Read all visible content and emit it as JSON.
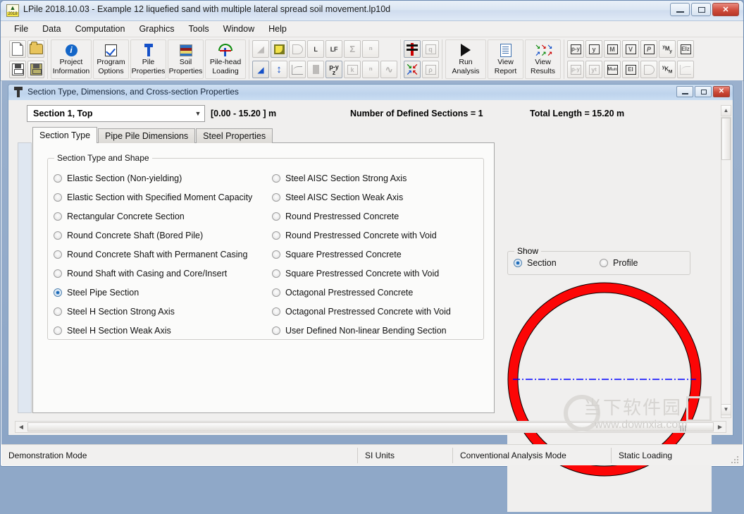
{
  "window": {
    "title": "LPile 2018.10.03 - Example 12 liquefied sand with multiple lateral spread soil movement.lp10d",
    "app_icon": "lpile-icon",
    "icon_year": "2018",
    "minimize_label": "Minimize",
    "maximize_label": "Maximize",
    "close_label": "Close"
  },
  "menu": {
    "items": [
      {
        "label": "File"
      },
      {
        "label": "Data"
      },
      {
        "label": "Computation"
      },
      {
        "label": "Graphics"
      },
      {
        "label": "Tools"
      },
      {
        "label": "Window"
      },
      {
        "label": "Help"
      }
    ]
  },
  "toolbar": {
    "file_buttons": [
      {
        "name": "new-file",
        "glyph": "new-document-icon"
      },
      {
        "name": "open-file",
        "glyph": "open-folder-icon"
      },
      {
        "name": "save-file",
        "glyph": "save-disk-icon"
      },
      {
        "name": "save-as-file",
        "glyph": "save-as-disk-icon"
      }
    ],
    "big_buttons": [
      {
        "name": "project-information",
        "line1": "Project",
        "line2": "Information",
        "icon": "info-circle-icon"
      },
      {
        "name": "program-options",
        "line1": "Program",
        "line2": "Options",
        "icon": "checkbox-icon"
      },
      {
        "name": "pile-properties",
        "line1": "Pile",
        "line2": "Properties",
        "icon": "pile-icon"
      },
      {
        "name": "soil-properties",
        "line1": "Soil",
        "line2": "Properties",
        "icon": "soil-layers-icon"
      },
      {
        "name": "pile-head-loading",
        "line1": "Pile-head",
        "line2": "Loading",
        "icon": "pile-head-load-icon"
      }
    ],
    "action_buttons": [
      {
        "name": "run-analysis",
        "line1": "Run",
        "line2": "Analysis",
        "icon": "play-triangle-icon"
      },
      {
        "name": "view-report",
        "line1": "View",
        "line2": "Report",
        "icon": "report-document-icon"
      },
      {
        "name": "view-results",
        "line1": "View",
        "line2": "Results",
        "icon": "colored-curves-icon"
      }
    ],
    "grid_icons_row1": [
      "soil-layer-chart-icon",
      "yellow-curve-icon",
      "d-shape-icon",
      "L",
      "LF",
      "Σ",
      "slope-icon"
    ],
    "grid_icons_row2": [
      "pile-section-icon",
      "updown-arrow-icon",
      "curve-icon",
      "column-icon",
      "p-y z",
      "k-icon",
      "slope-icon-2",
      "s-curve-icon"
    ],
    "load_icons": [
      "pile-top-load-icon",
      "q",
      "colored-arrows-icon",
      "rho"
    ],
    "result_icons_row1": [
      "p-y",
      "y",
      "M",
      "V",
      "P",
      "yMy",
      "EIz"
    ],
    "result_icons_row2": [
      "p-y",
      "yt",
      "Mult",
      "EI",
      "d-shape",
      "yKm",
      "curve-dim"
    ]
  },
  "child_window": {
    "title": "Section Type, Dimensions, and Cross-section Properties",
    "icon": "pile-section-icon",
    "minimize_label": "Minimize",
    "maximize_label": "Maximize",
    "close_label": "Close"
  },
  "section_bar": {
    "selected_section": "Section 1, Top",
    "dropdown_options": [
      "Section 1, Top"
    ],
    "depth_range": "[0.00 - 15.20 ] m",
    "defined_sections": "Number of Defined Sections = 1",
    "total_length": "Total Length = 15.20 m"
  },
  "tabs": [
    {
      "label": "Section Type",
      "active": true
    },
    {
      "label": "Pipe Pile Dimensions",
      "active": false
    },
    {
      "label": "Steel Properties",
      "active": false
    }
  ],
  "section_type_group": {
    "title": "Section Type and Shape",
    "left_column": [
      {
        "label": "Elastic Section (Non-yielding)",
        "checked": false
      },
      {
        "label": "Elastic Section with Specified Moment Capacity",
        "checked": false
      },
      {
        "label": "Rectangular Concrete Section",
        "checked": false
      },
      {
        "label": "Round Concrete Shaft (Bored Pile)",
        "checked": false
      },
      {
        "label": "Round Concrete Shaft with Permanent Casing",
        "checked": false
      },
      {
        "label": "Round Shaft with Casing and Core/Insert",
        "checked": false
      },
      {
        "label": "Steel Pipe Section",
        "checked": true
      },
      {
        "label": "Steel H Section Strong Axis",
        "checked": false
      },
      {
        "label": "Steel H Section Weak Axis",
        "checked": false
      }
    ],
    "right_column": [
      {
        "label": "Steel AISC Section Strong Axis",
        "checked": false
      },
      {
        "label": "Steel AISC Section Weak Axis",
        "checked": false
      },
      {
        "label": "Round Prestressed Concrete",
        "checked": false
      },
      {
        "label": "Round Prestressed Concrete  with Void",
        "checked": false
      },
      {
        "label": "Square Prestressed Concrete",
        "checked": false
      },
      {
        "label": "Square Prestressed Concrete with Void",
        "checked": false
      },
      {
        "label": "Octagonal Prestressed Concrete",
        "checked": false
      },
      {
        "label": "Octagonal Prestressed Concrete  with Void",
        "checked": false
      },
      {
        "label": "User Defined Non-linear Bending Section",
        "checked": false
      }
    ]
  },
  "show_group": {
    "title": "Show",
    "options": [
      {
        "label": "Section",
        "checked": true
      },
      {
        "label": "Profile",
        "checked": false
      }
    ]
  },
  "preview": {
    "shape": "pipe-cross-section",
    "ring_color": "#fc0606",
    "outline_color": "#000000",
    "centerline_color": "#0000ff",
    "background": "#f0efee"
  },
  "status_bar": {
    "mode": "Demonstration Mode",
    "units": "SI Units",
    "analysis_mode": "Conventional Analysis Mode",
    "loading": "Static Loading"
  },
  "watermark": {
    "cn": "当下软件园",
    "url": "www.downxia.com"
  }
}
